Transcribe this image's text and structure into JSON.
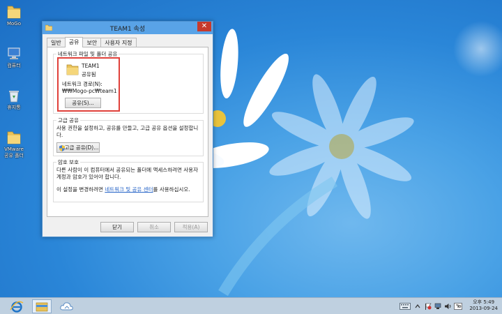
{
  "desktop": {
    "icons": [
      {
        "label": "MoGo",
        "icon": "folder-icon"
      },
      {
        "label": "컴퓨터",
        "icon": "computer-icon"
      },
      {
        "label": "휴지통",
        "icon": "recycle-bin-icon"
      },
      {
        "label": "VMware\n공유 폴더",
        "icon": "folder-icon"
      }
    ]
  },
  "window": {
    "title": "TEAM1 속성",
    "tabs": [
      {
        "label": "일반",
        "active": false
      },
      {
        "label": "공유",
        "active": true
      },
      {
        "label": "보안",
        "active": false
      },
      {
        "label": "사용자 지정",
        "active": false
      }
    ],
    "network_share": {
      "group_title": "네트워크 파일 및 폴더 공유",
      "folder_name": "TEAM1",
      "share_state": "공유됨",
      "network_path_label": "네트워크 경로(N):",
      "network_path_value": "₩₩Mogo-pc₩team1",
      "share_button": "공유(S)..."
    },
    "advanced_share": {
      "group_title": "고급 공유",
      "description": "사용 권한을 설정하고, 공유를 만들고, 고급 공유 옵션을 설정합니다.",
      "button": "고급 공유(D)..."
    },
    "password_protect": {
      "group_title": "암호 보호",
      "description": "다른 사람이 이 컴퓨터에서 공유되는 폴더에 액세스하려면 사용자 계정과 암호가 있어야 합니다.",
      "change_prefix": "이 설정을 변경하려면 ",
      "link_text": "네트워크 및 공유 센터",
      "change_suffix": "를 사용하십시오."
    },
    "buttons": {
      "close": "닫기",
      "cancel": "취소",
      "apply": "적용(A)"
    },
    "close_glyph": "✕"
  },
  "taskbar": {
    "items": [
      {
        "name": "internet-explorer-icon",
        "active": false
      },
      {
        "name": "file-explorer-icon",
        "active": true
      },
      {
        "name": "cloud-app-icon",
        "active": false
      }
    ],
    "clock": {
      "time": "오후 5:49",
      "date": "2013-09-24"
    }
  },
  "colors": {
    "close_button": "#c7392c",
    "highlight_border": "#e0403a",
    "titlebar": "#59a3e7",
    "link": "#2563c7"
  }
}
